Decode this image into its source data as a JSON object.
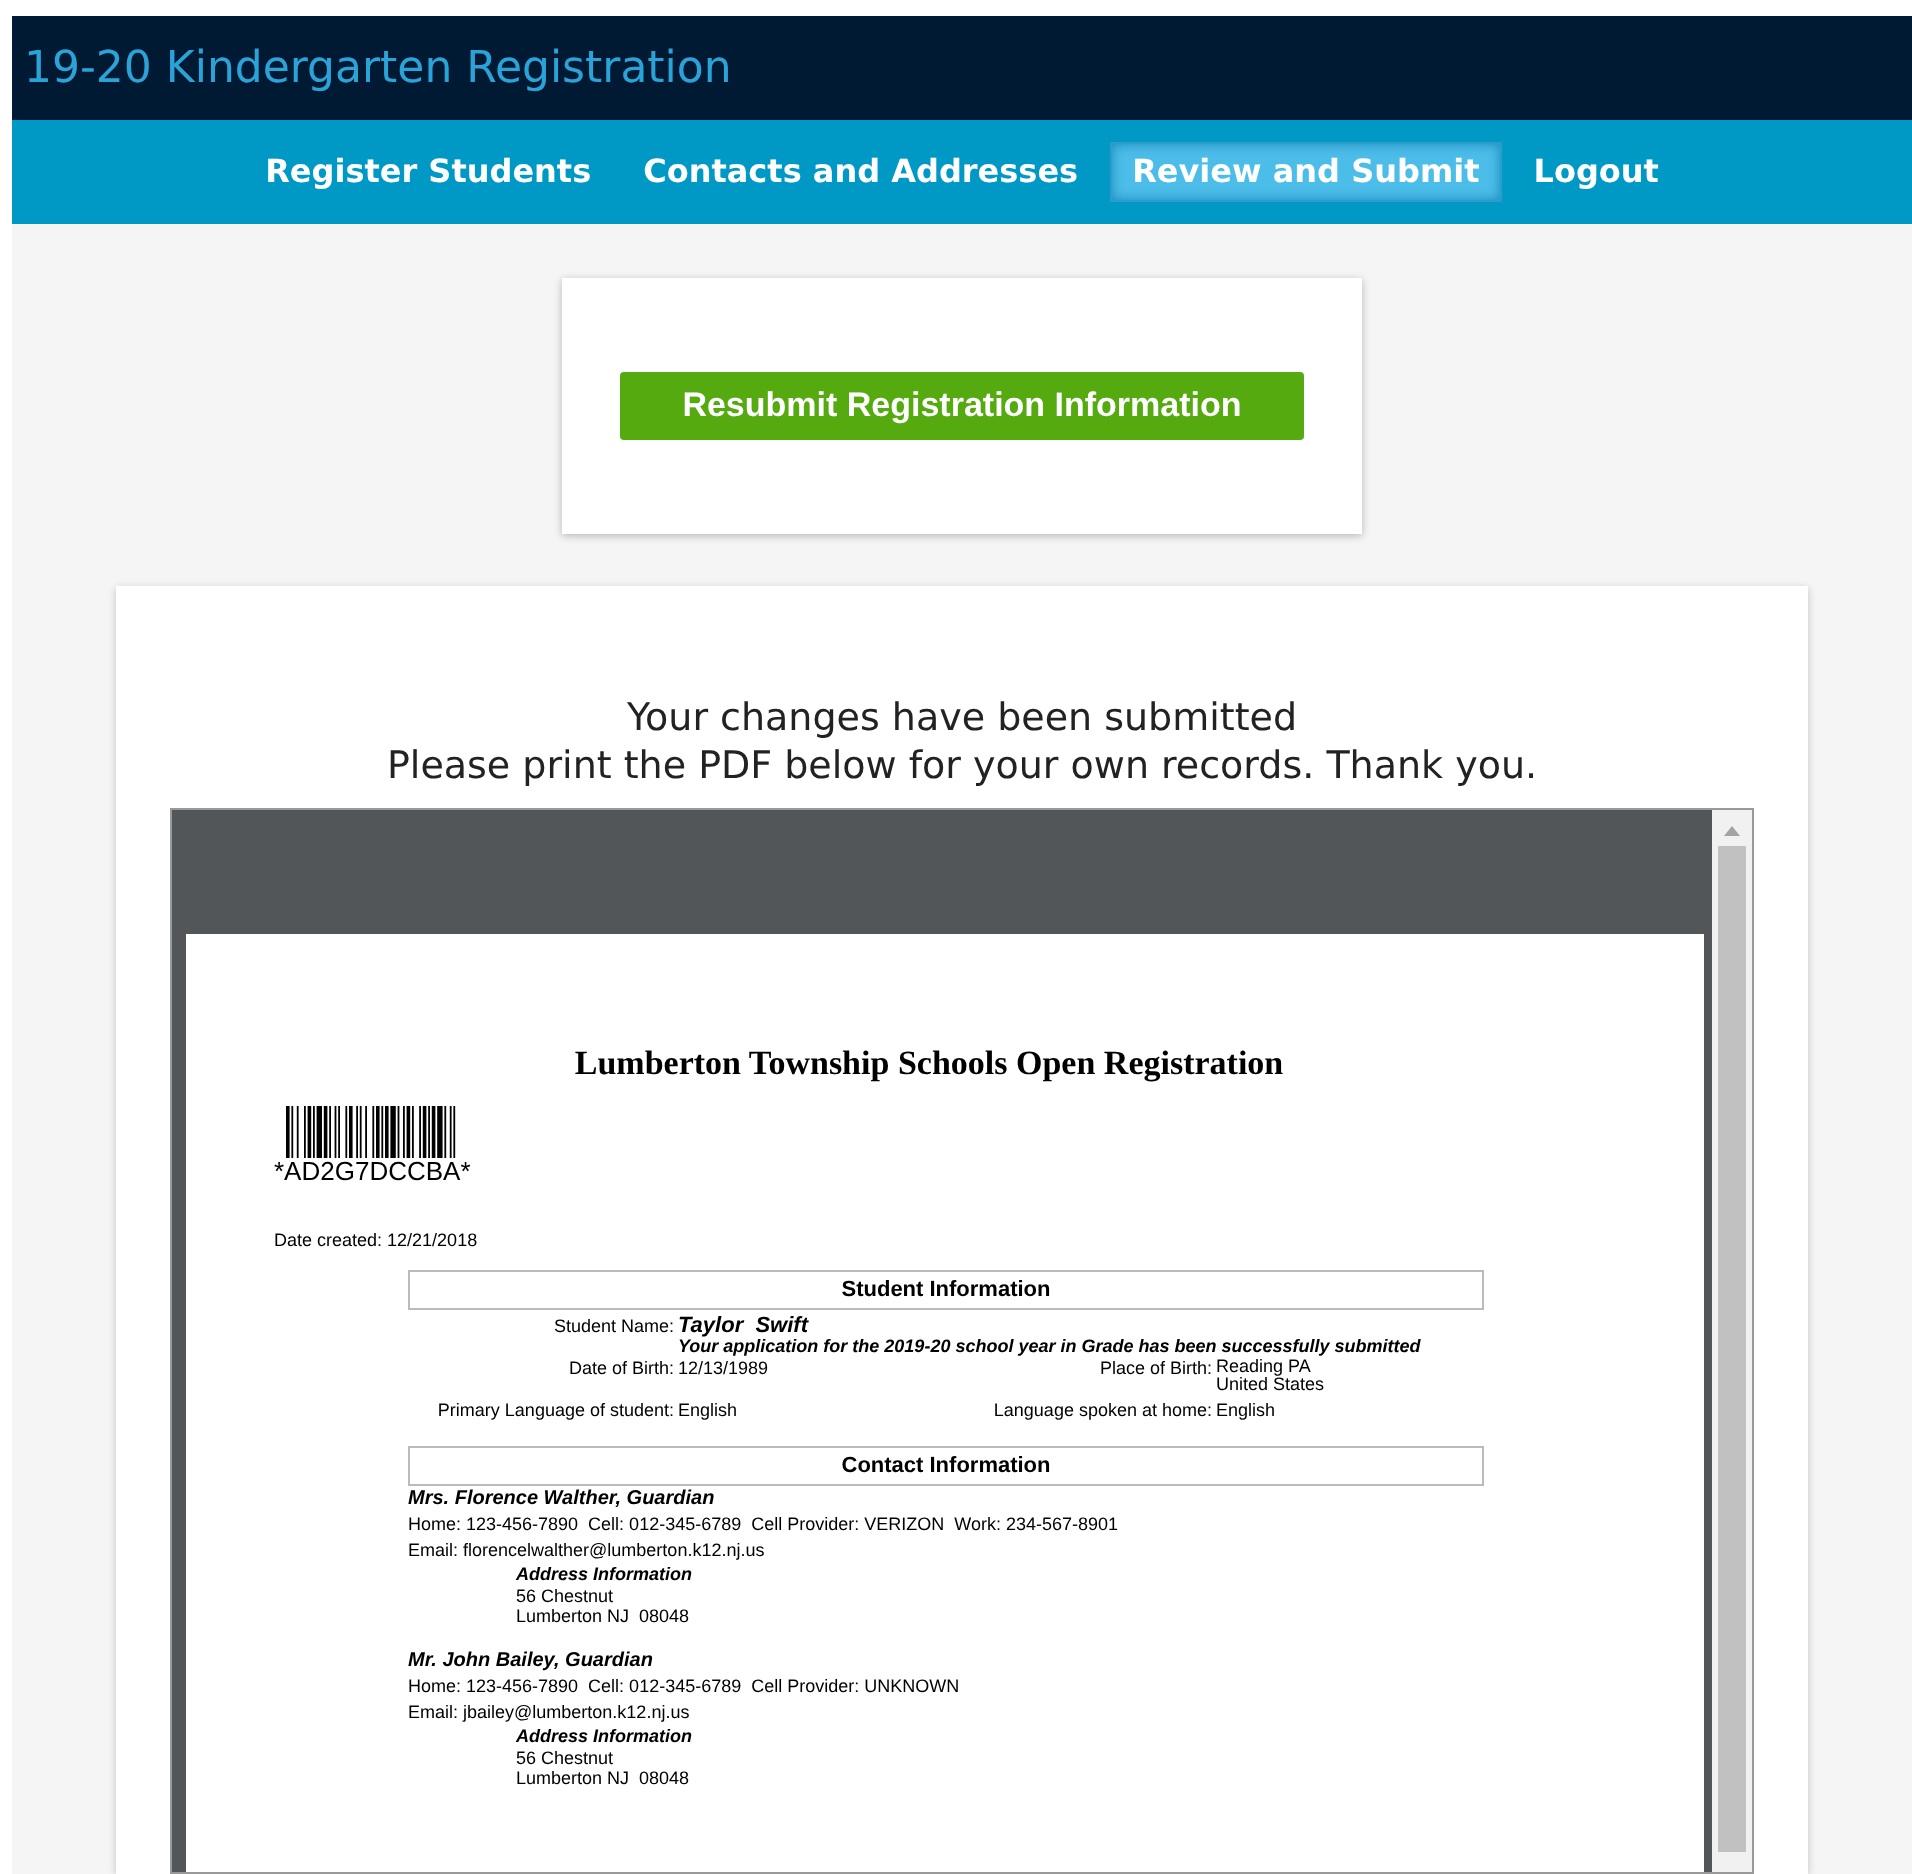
{
  "header": {
    "title": "19-20 Kindergarten Registration"
  },
  "nav": [
    {
      "label": "Register Students",
      "selected": false
    },
    {
      "label": "Contacts and Addresses",
      "selected": false
    },
    {
      "label": "Review and Submit",
      "selected": true
    },
    {
      "label": "Logout",
      "selected": false
    }
  ],
  "resubmit_button": "Resubmit Registration Information",
  "message": [
    "Your changes have been submitted",
    "Please print the PDF below for your own records. Thank you."
  ],
  "pdf": {
    "title": "Lumberton Township Schools Open Registration",
    "barcode_text": "*AD2G7DCCBA*",
    "date_created": "Date created: 12/21/2018",
    "student_section": {
      "heading": "Student Information",
      "name_label": "Student Name:",
      "name_value": "Taylor  Swift",
      "note": "Your application for the 2019-20 school year in Grade  has been successfully submitted",
      "dob_label": "Date of Birth:",
      "dob_value": "12/13/1989",
      "pob_label": "Place of Birth:",
      "pob_value": [
        "Reading PA",
        "United States"
      ],
      "lang_label": "Primary Language of student:",
      "lang_value": "English",
      "home_lang_label": "Language spoken at home:",
      "home_lang_value": "English"
    },
    "contact_section": {
      "heading": "Contact Information",
      "contacts": [
        {
          "name": "Mrs. Florence Walther, Guardian",
          "phones": "Home: 123-456-7890  Cell: 012-345-6789  Cell Provider: VERIZON  Work: 234-567-8901",
          "email": "Email: florencelwalther@lumberton.k12.nj.us",
          "address_heading": "Address Information",
          "address": [
            "56 Chestnut",
            "Lumberton NJ  08048"
          ]
        },
        {
          "name": "Mr. John Bailey, Guardian",
          "phones": "Home: 123-456-7890  Cell: 012-345-6789  Cell Provider: UNKNOWN",
          "email": "Email: jbailey@lumberton.k12.nj.us",
          "address_heading": "Address Information",
          "address": [
            "56 Chestnut",
            "Lumberton NJ  08048"
          ]
        }
      ]
    }
  }
}
